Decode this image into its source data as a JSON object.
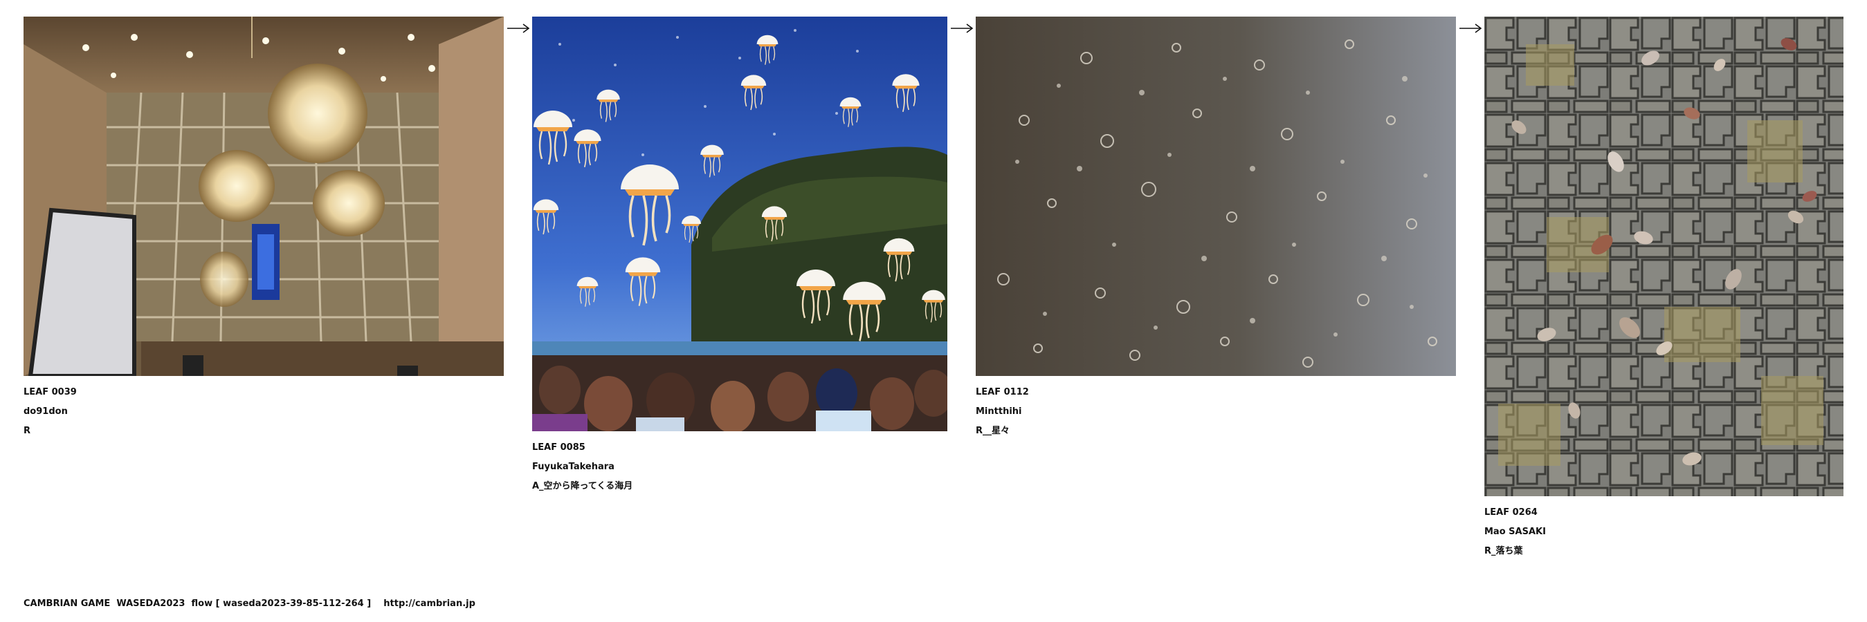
{
  "leaves": [
    {
      "id": "LEAF 0039",
      "author": "do91don",
      "caption": "R",
      "image": "indoor hall with crystal chandeliers and stained glass window"
    },
    {
      "id": "LEAF 0085",
      "author": "FuyukaTakehara",
      "caption": "A_空から降ってくる海月",
      "image": "jellyfish falling from blue sky over a cheering crowd"
    },
    {
      "id": "LEAF 0112",
      "author": "Mintthihi",
      "caption": "R__星々",
      "image": "dark surface covered with small white translucent spots"
    },
    {
      "id": "LEAF 0264",
      "author": "Mao SASAKI",
      "caption": "R_落ち葉",
      "image": "grey interlocking paving stones with fallen leaves"
    }
  ],
  "arrow_icon": "right-arrow-icon",
  "footer": {
    "text": "CAMBRIAN GAME  WASEDA2023  flow [ waseda2023-39-85-112-264 ]",
    "url": "http://cambrian.jp"
  }
}
